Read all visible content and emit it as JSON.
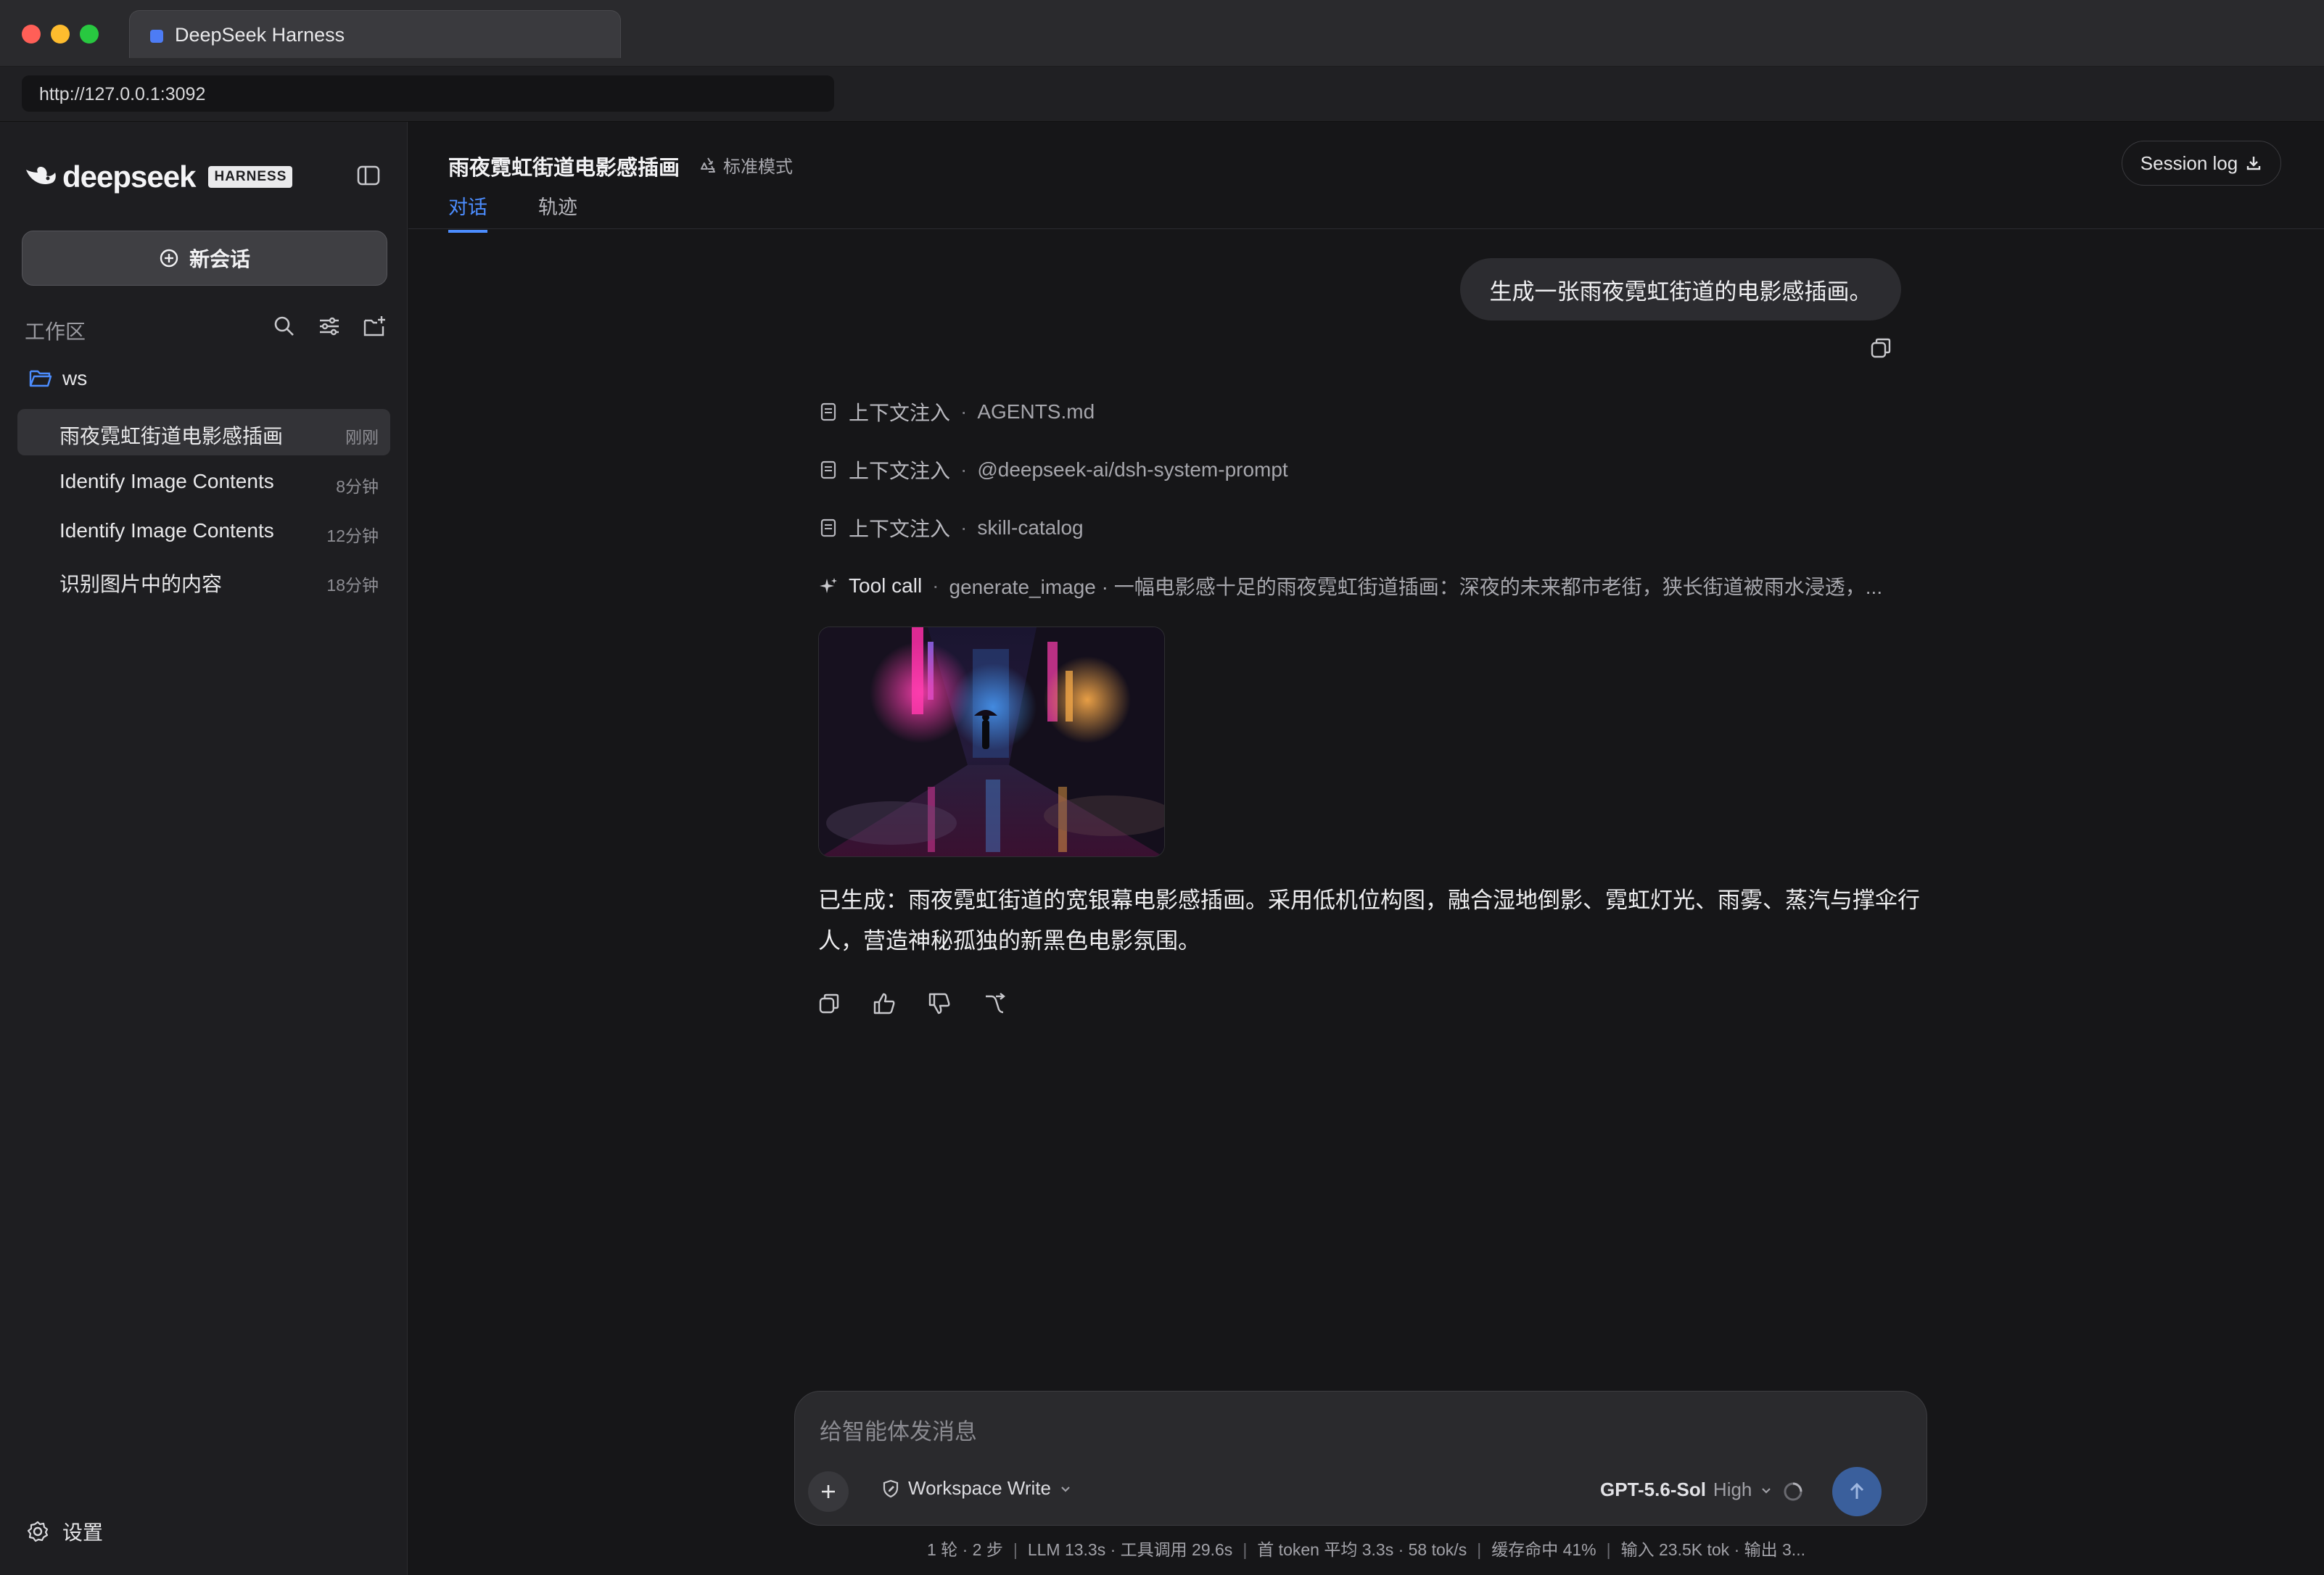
{
  "browser": {
    "tab_title": "DeepSeek Harness",
    "url": "http://127.0.0.1:3092"
  },
  "sidebar": {
    "logo_text": "deepseek",
    "logo_badge": "HARNESS",
    "new_chat_label": "新会话",
    "workspace_title": "工作区",
    "folder_label": "ws",
    "sessions": [
      {
        "title": "雨夜霓虹街道电影感插画",
        "time": "刚刚",
        "active": true
      },
      {
        "title": "Identify Image Contents",
        "time": "8分钟"
      },
      {
        "title": "Identify Image Contents",
        "time": "12分钟"
      },
      {
        "title": "识别图片中的内容",
        "time": "18分钟"
      }
    ],
    "settings_label": "设置"
  },
  "header": {
    "title": "雨夜霓虹街道电影感插画",
    "mode_label": "标准模式",
    "tabs": [
      {
        "label": "对话",
        "active": true
      },
      {
        "label": "轨迹"
      }
    ],
    "session_log_label": "Session log"
  },
  "conversation": {
    "user_message": "生成一张雨夜霓虹街道的电影感插画。",
    "context_items": [
      {
        "label": "上下文注入",
        "value": "AGENTS.md"
      },
      {
        "label": "上下文注入",
        "value": "@deepseek-ai/dsh-system-prompt"
      },
      {
        "label": "上下文注入",
        "value": "skill-catalog"
      }
    ],
    "tool_call": {
      "label": "Tool call",
      "summary": "generate_image · 一幅电影感十足的雨夜霓虹街道插画：深夜的未来都市老街，狭长街道被雨水浸透，..."
    },
    "answer": "已生成：雨夜霓虹街道的宽银幕电影感插画。采用低机位构图，融合湿地倒影、霓虹灯光、雨雾、蒸汽与撑伞行人，营造神秘孤独的新黑色电影氛围。"
  },
  "composer": {
    "placeholder": "给智能体发消息",
    "permission_label": "Workspace Write",
    "model_name": "GPT-5.6-Sol",
    "model_effort": "High"
  },
  "status": {
    "turns": "1 轮 · 2 步",
    "llm": "LLM 13.3s · 工具调用 29.6s",
    "first_token": "首 token 平均 3.3s · 58 tok/s",
    "cache": "缓存命中 41%",
    "io": "输入 23.5K tok · 输出 3..."
  },
  "colors": {
    "accent": "#4c8dff",
    "background": "#161618",
    "sidebar": "#1e1e21",
    "send_button": "#3a5f9c"
  }
}
